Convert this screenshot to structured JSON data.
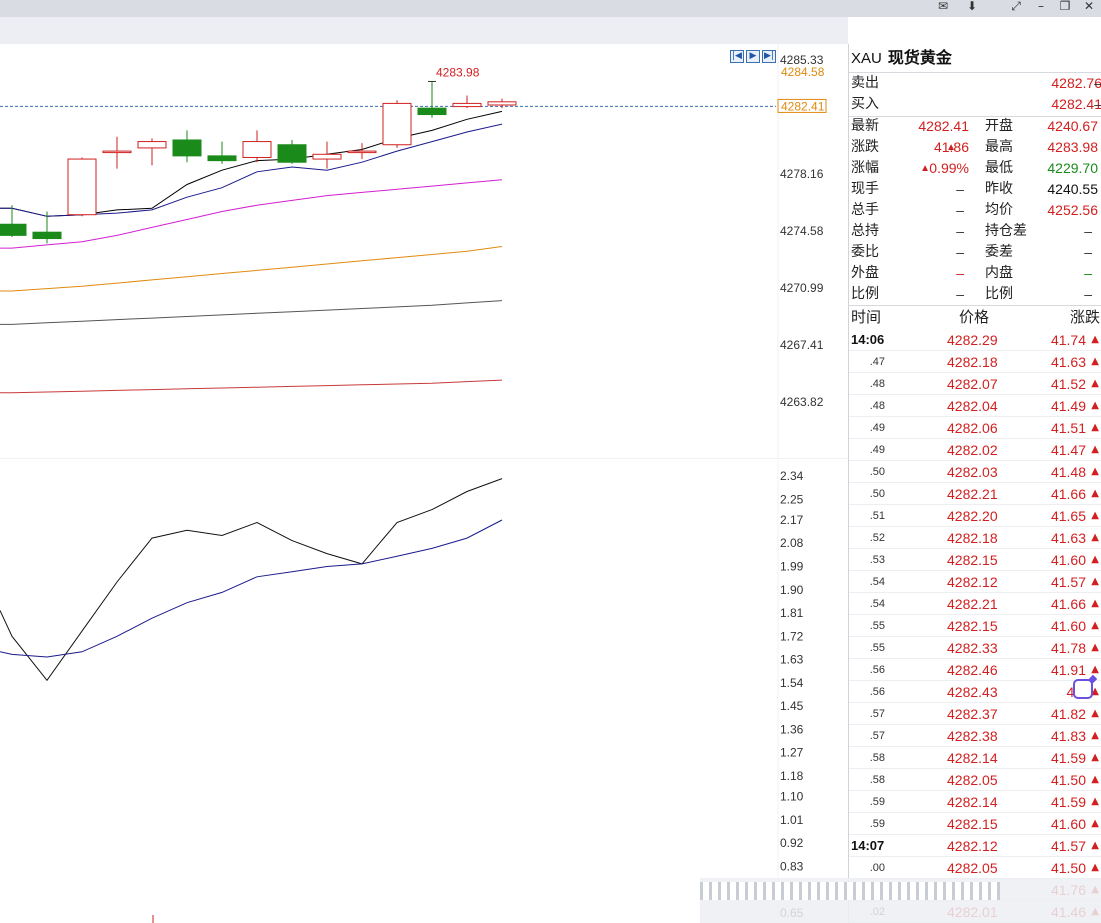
{
  "window_controls": [
    "✉",
    "⬇",
    "⤢",
    "–",
    "❐",
    "✕"
  ],
  "nav_buttons": [
    "|◀",
    "▶",
    "▶|"
  ],
  "main_chart": {
    "price_axis": [
      "4285.33",
      "4278.16",
      "4274.58",
      "4270.99",
      "4267.41",
      "4263.82"
    ],
    "sell_marker": "4284.58",
    "last_marker": "4282.41",
    "high_label": "4283.98",
    "candles": [
      {
        "o": 4275.0,
        "h": 4276.2,
        "l": 4274.2,
        "c": 4274.3
      },
      {
        "o": 4274.5,
        "h": 4275.8,
        "l": 4273.8,
        "c": 4274.1
      },
      {
        "o": 4275.6,
        "h": 4279.2,
        "l": 4275.5,
        "c": 4279.1
      },
      {
        "o": 4279.6,
        "h": 4280.5,
        "l": 4278.5,
        "c": 4279.6
      },
      {
        "o": 4279.8,
        "h": 4280.4,
        "l": 4278.7,
        "c": 4280.2
      },
      {
        "o": 4280.3,
        "h": 4280.9,
        "l": 4278.9,
        "c": 4279.3
      },
      {
        "o": 4279.3,
        "h": 4280.2,
        "l": 4278.8,
        "c": 4279.0
      },
      {
        "o": 4279.2,
        "h": 4280.9,
        "l": 4278.9,
        "c": 4280.2
      },
      {
        "o": 4280.0,
        "h": 4280.3,
        "l": 4278.8,
        "c": 4278.9
      },
      {
        "o": 4279.1,
        "h": 4280.2,
        "l": 4278.5,
        "c": 4279.4
      },
      {
        "o": 4279.6,
        "h": 4280.1,
        "l": 4279.1,
        "c": 4279.6
      },
      {
        "o": 4280.0,
        "h": 4282.8,
        "l": 4279.8,
        "c": 4282.6
      },
      {
        "o": 4282.3,
        "h": 4283.98,
        "l": 4281.7,
        "c": 4281.9
      },
      {
        "o": 4282.4,
        "h": 4283.1,
        "l": 4282.3,
        "c": 4282.6
      },
      {
        "o": 4282.5,
        "h": 4282.9,
        "l": 4282.3,
        "c": 4282.7
      }
    ],
    "ma_lines": [
      {
        "color": "#000000",
        "values": [
          4276.0,
          4275.5,
          4275.6,
          4275.9,
          4276.0,
          4277.5,
          4278.4,
          4279.0,
          4279.1,
          4279.4,
          4279.7,
          4280.4,
          4280.9,
          4281.6,
          4282.1
        ]
      },
      {
        "color": "#1a1a8c",
        "values": [
          4276.0,
          4275.5,
          4275.6,
          4275.7,
          4275.9,
          4276.7,
          4277.3,
          4278.3,
          4278.6,
          4278.4,
          4278.9,
          4279.6,
          4280.2,
          4280.8,
          4281.3
        ]
      },
      {
        "color": "#d21fd2",
        "values": [
          4273.5,
          4273.7,
          4273.9,
          4274.3,
          4274.8,
          4275.3,
          4275.8,
          4276.2,
          4276.5,
          4276.8,
          4277.0,
          4277.2,
          4277.4,
          4277.6,
          4277.8
        ]
      },
      {
        "color": "#e08a10",
        "values": [
          4270.8,
          4270.95,
          4271.1,
          4271.3,
          4271.5,
          4271.7,
          4271.9,
          4272.1,
          4272.3,
          4272.5,
          4272.7,
          4272.9,
          4273.1,
          4273.3,
          4273.6
        ]
      },
      {
        "color": "#555555",
        "values": [
          4268.7,
          4268.8,
          4268.9,
          4269.0,
          4269.1,
          4269.2,
          4269.3,
          4269.4,
          4269.5,
          4269.6,
          4269.7,
          4269.8,
          4269.9,
          4270.05,
          4270.2
        ]
      },
      {
        "color": "#c83a3a",
        "values": [
          4264.4,
          4264.45,
          4264.5,
          4264.55,
          4264.6,
          4264.65,
          4264.7,
          4264.75,
          4264.8,
          4264.85,
          4264.9,
          4264.95,
          4265.0,
          4265.1,
          4265.2
        ]
      }
    ]
  },
  "sub_chart": {
    "axis": [
      "2.34",
      "2.25",
      "2.17",
      "2.08",
      "1.99",
      "1.90",
      "1.81",
      "1.72",
      "1.63",
      "1.54",
      "1.45",
      "1.36",
      "1.27",
      "1.18",
      "1.10",
      "1.01",
      "0.92",
      "0.83",
      "0.65"
    ],
    "line_fast": [
      1.72,
      1.55,
      1.74,
      1.93,
      2.1,
      2.13,
      2.11,
      2.16,
      2.09,
      2.04,
      2.0,
      2.16,
      2.21,
      2.28,
      2.33
    ],
    "line_slow": [
      1.65,
      1.64,
      1.66,
      1.72,
      1.79,
      1.85,
      1.89,
      1.95,
      1.97,
      1.99,
      2.0,
      2.03,
      2.06,
      2.1,
      2.17
    ]
  },
  "quote": {
    "code": "XAU",
    "name": "现货黄金",
    "sell_label": "卖出",
    "sell_value": "4282.76",
    "sell_vol": "–",
    "buy_label": "买入",
    "buy_value": "4282.41",
    "buy_vol": "–",
    "last_label": "最新",
    "last_value": "4282.41",
    "open_label": "开盘",
    "open_value": "4240.67",
    "change_label": "涨跌",
    "change_value": "41.86",
    "high_label": "最高",
    "high_value": "4283.98",
    "pct_label": "涨幅",
    "pct_value": "0.99%",
    "low_label": "最低",
    "low_value": "4229.70",
    "hand_label": "现手",
    "hand_value": "–",
    "prev_label": "昨收",
    "prev_value": "4240.55",
    "total_hand_label": "总手",
    "total_hand_value": "–",
    "avg_label": "均价",
    "avg_value": "4252.56",
    "hold_label": "总持",
    "hold_value": "–",
    "hold_diff_label": "持仓差",
    "hold_diff_value": "–",
    "ratio_label": "委比",
    "ratio_value": "–",
    "diff_label": "委差",
    "diff_value": "–",
    "outer_label": "外盘",
    "outer_value": "–",
    "inner_label": "内盘",
    "inner_value": "–",
    "scale_label": "比例",
    "scale_value": "–",
    "scale2_label": "比例",
    "scale2_value": "–"
  },
  "ticks_header": {
    "time": "时间",
    "price": "价格",
    "change": "涨跌"
  },
  "ticks": [
    {
      "time": "14:06",
      "price": "4282.29",
      "change": "41.74"
    },
    {
      "time": ".47",
      "price": "4282.18",
      "change": "41.63"
    },
    {
      "time": ".48",
      "price": "4282.07",
      "change": "41.52"
    },
    {
      "time": ".48",
      "price": "4282.04",
      "change": "41.49"
    },
    {
      "time": ".49",
      "price": "4282.06",
      "change": "41.51"
    },
    {
      "time": ".49",
      "price": "4282.02",
      "change": "41.47"
    },
    {
      "time": ".50",
      "price": "4282.03",
      "change": "41.48"
    },
    {
      "time": ".50",
      "price": "4282.21",
      "change": "41.66"
    },
    {
      "time": ".51",
      "price": "4282.20",
      "change": "41.65"
    },
    {
      "time": ".52",
      "price": "4282.18",
      "change": "41.63"
    },
    {
      "time": ".53",
      "price": "4282.15",
      "change": "41.60"
    },
    {
      "time": ".54",
      "price": "4282.12",
      "change": "41.57"
    },
    {
      "time": ".54",
      "price": "4282.21",
      "change": "41.66"
    },
    {
      "time": ".55",
      "price": "4282.15",
      "change": "41.60"
    },
    {
      "time": ".55",
      "price": "4282.33",
      "change": "41.78"
    },
    {
      "time": ".56",
      "price": "4282.46",
      "change": "41.91"
    },
    {
      "time": ".56",
      "price": "4282.43",
      "change": "41."
    },
    {
      "time": ".57",
      "price": "4282.37",
      "change": "41.82"
    },
    {
      "time": ".57",
      "price": "4282.38",
      "change": "41.83"
    },
    {
      "time": ".58",
      "price": "4282.14",
      "change": "41.59"
    },
    {
      "time": ".58",
      "price": "4282.05",
      "change": "41.50"
    },
    {
      "time": ".59",
      "price": "4282.14",
      "change": "41.59"
    },
    {
      "time": ".59",
      "price": "4282.15",
      "change": "41.60"
    },
    {
      "time": "14:07",
      "price": "4282.12",
      "change": "41.57"
    },
    {
      "time": ".00",
      "price": "4282.05",
      "change": "41.50"
    },
    {
      "time": ".01",
      "price": "4282.31",
      "change": "41.76"
    },
    {
      "time": ".02",
      "price": "4282.01",
      "change": "41.46"
    }
  ],
  "colors": {
    "up": "#d21f1f",
    "down": "#1a8a1a",
    "accent": "#3a6fb0"
  }
}
